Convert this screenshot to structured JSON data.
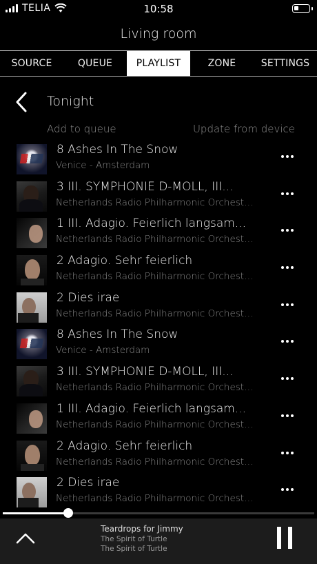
{
  "status_bar": {
    "carrier": "TELIA",
    "time": "10:58"
  },
  "room": {
    "title": "Living room"
  },
  "tabs": [
    {
      "label": "SOURCE",
      "active": false
    },
    {
      "label": "QUEUE",
      "active": false
    },
    {
      "label": "PLAYLIST",
      "active": true
    },
    {
      "label": "ZONE",
      "active": false
    },
    {
      "label": "SETTINGS",
      "active": false
    }
  ],
  "playlist": {
    "name": "Tonight",
    "add_to_queue": "Add to queue",
    "update_from_device": "Update from device"
  },
  "tracks": [
    {
      "title": "8 Ashes In The Snow",
      "subtitle": "Venice - Amsterdam",
      "art": "a"
    },
    {
      "title": "3 III. SYMPHONIE D-MOLL, III...",
      "subtitle": "Netherlands Radio Philharmonic Orchestr...",
      "art": "b"
    },
    {
      "title": "1 III. Adagio. Feierlich langsam...",
      "subtitle": "Netherlands Radio Philharmonic Orchestr...",
      "art": "c"
    },
    {
      "title": "2 Adagio. Sehr feierlich",
      "subtitle": "Netherlands Radio Philharmonic Orchestr...",
      "art": "d"
    },
    {
      "title": "2 Dies irae",
      "subtitle": "Netherlands Radio Philharmonic Orchestr...",
      "art": "e"
    },
    {
      "title": "8 Ashes In The Snow",
      "subtitle": "Venice - Amsterdam",
      "art": "a"
    },
    {
      "title": "3 III. SYMPHONIE D-MOLL, III...",
      "subtitle": "Netherlands Radio Philharmonic Orchestr...",
      "art": "b"
    },
    {
      "title": "1 III. Adagio. Feierlich langsam...",
      "subtitle": "Netherlands Radio Philharmonic Orchestr...",
      "art": "c"
    },
    {
      "title": "2 Adagio. Sehr feierlich",
      "subtitle": "Netherlands Radio Philharmonic Orchestr...",
      "art": "d"
    },
    {
      "title": "2 Dies irae",
      "subtitle": "Netherlands Radio Philharmonic Orchestr...",
      "art": "e"
    }
  ],
  "now_playing": {
    "title": "Teardrops for Jimmy",
    "artist": "The Spirit of Turtle",
    "album": "The Spirit of Turtle",
    "progress": 0.21
  }
}
